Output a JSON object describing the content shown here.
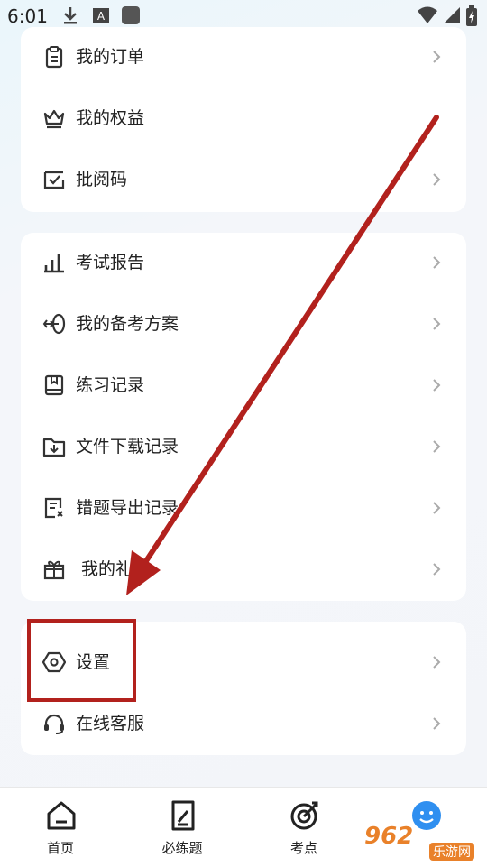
{
  "status_bar": {
    "time": "6:01",
    "left_icons": [
      "download-icon",
      "keyboard-a-icon",
      "app-icon"
    ],
    "right_icons": [
      "wifi-icon",
      "signal-icon",
      "battery-charging-icon"
    ]
  },
  "cards": [
    {
      "items": [
        {
          "icon": "clipboard-icon",
          "label": "我的订单",
          "chevron": true
        },
        {
          "icon": "crown-icon",
          "label": "我的权益",
          "chevron": false
        },
        {
          "icon": "checkbox-icon",
          "label": "批阅码",
          "chevron": true
        }
      ]
    },
    {
      "items": [
        {
          "icon": "bar-chart-icon",
          "label": "考试报告",
          "chevron": true
        },
        {
          "icon": "target-arrow-icon",
          "label": "我的备考方案",
          "chevron": true
        },
        {
          "icon": "book-icon",
          "label": "练习记录",
          "chevron": true
        },
        {
          "icon": "folder-download-icon",
          "label": "文件下载记录",
          "chevron": true
        },
        {
          "icon": "document-x-icon",
          "label": "错题导出记录",
          "chevron": true
        },
        {
          "icon": "gift-icon",
          "label": "我的礼包",
          "chevron": true
        }
      ]
    },
    {
      "items": [
        {
          "icon": "hexagon-settings-icon",
          "label": "设置",
          "chevron": true
        },
        {
          "icon": "headset-icon",
          "label": "在线客服",
          "chevron": true
        }
      ]
    }
  ],
  "tabbar": [
    {
      "icon": "home-icon",
      "label": "首页"
    },
    {
      "icon": "note-edit-icon",
      "label": "必练题"
    },
    {
      "icon": "target-icon",
      "label": "考点"
    },
    {
      "icon": "avatar-icon",
      "label": ""
    }
  ],
  "watermark": {
    "text": "962",
    "sub": "乐游网"
  },
  "colors": {
    "highlight": "#b2211d",
    "watermark": "#e9812a",
    "avatar": "#2f8ff0"
  }
}
